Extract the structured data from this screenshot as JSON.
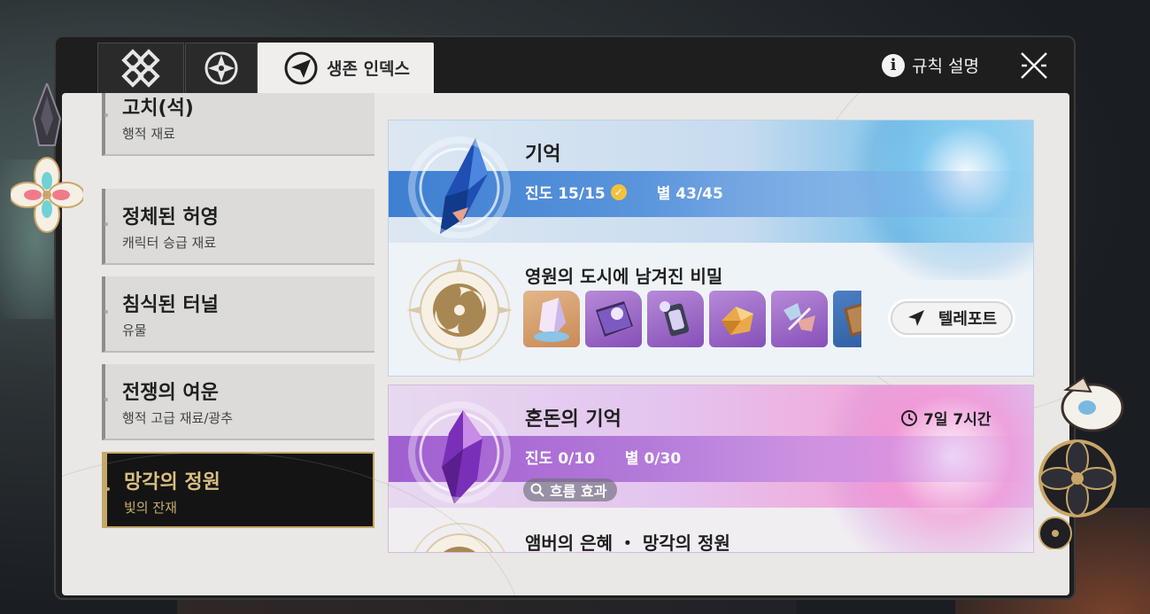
{
  "header": {
    "tabs": [
      {
        "icon": "diamond-grid-icon"
      },
      {
        "icon": "compass-wheel-icon"
      },
      {
        "label": "생존 인덱스",
        "icon": "paper-plane-badge-icon"
      }
    ],
    "rules_label": "규칙 설명"
  },
  "sidebar": {
    "items": [
      {
        "title": "고치(석)",
        "subtitle": "행적 재료"
      },
      {
        "title": "정체된 허영",
        "subtitle": "캐릭터 승급 재료"
      },
      {
        "title": "침식된 터널",
        "subtitle": "유물"
      },
      {
        "title": "전쟁의 여운",
        "subtitle": "행적 고급 재료/광추"
      },
      {
        "title": "망각의 정원",
        "subtitle": "빛의 잔재",
        "selected": true
      }
    ]
  },
  "cards": [
    {
      "title": "기억",
      "progress": "진도 15/15",
      "stars": "별 43/45",
      "stage_title": "영원의 도시에 남겨진 비밀",
      "rewards": [
        "crystal-shard",
        "purple-book",
        "lantern",
        "gold-ore",
        "feather-relic",
        "brown-book"
      ],
      "teleport_label": "텔레포트",
      "accent": "#3e7fd2"
    },
    {
      "title": "혼돈의 기억",
      "timer": "7일 7시간",
      "progress": "진도 0/10",
      "stars": "별 0/30",
      "flow_label": "흐름 효과",
      "stage_title": "앰버의 은혜 ・ 망각의 정원",
      "accent": "#a05fd0"
    }
  ],
  "colors": {
    "panel": "#e9e8e6",
    "frame": "#1e1e1e",
    "selected_gold": "#c4a867"
  }
}
